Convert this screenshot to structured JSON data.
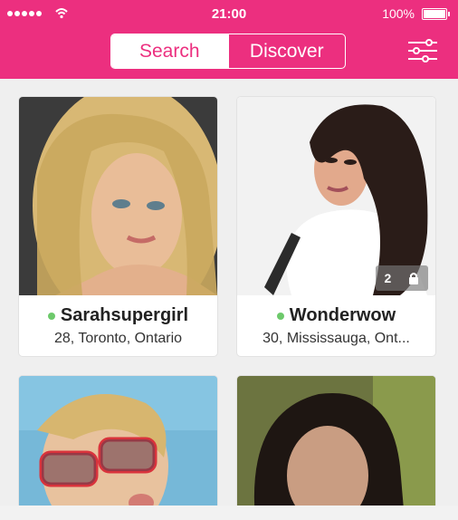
{
  "status": {
    "time": "21:00",
    "battery": "100%"
  },
  "tabs": {
    "search": "Search",
    "discover": "Discover"
  },
  "profiles": [
    {
      "name": "Sarahsupergirl",
      "details": "28, Toronto, Ontario",
      "online": true
    },
    {
      "name": "Wonderwow",
      "details": "30, Mississauga, Ont...",
      "online": true,
      "photo_count": "2"
    }
  ],
  "colors": {
    "accent": "#ec2f7f",
    "online": "#6dc96b"
  }
}
